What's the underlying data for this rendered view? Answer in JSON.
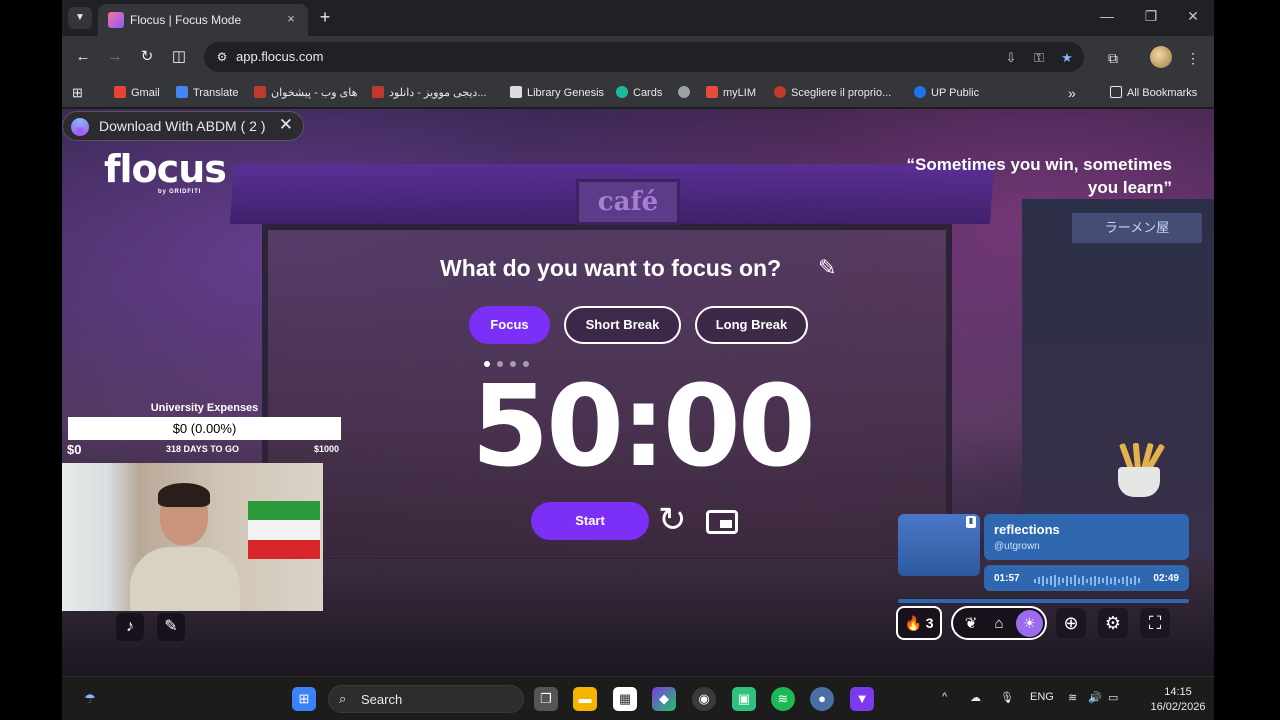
{
  "browser": {
    "tab_title": "Flocus | Focus Mode",
    "tab_close": "×",
    "new_tab": "+",
    "window_controls": {
      "minimize": "—",
      "maximize": "❐",
      "close": "✕"
    },
    "url": "app.flocus.com",
    "bookmarks": [
      {
        "label": "Gmail",
        "color": "#ea4335"
      },
      {
        "label": "Translate",
        "color": "#4285f4"
      },
      {
        "label": "های وب - پیشخوان",
        "color": "#c0392b"
      },
      {
        "label": "دیجی موویز - دانلود...",
        "color": "#c0392b"
      },
      {
        "label": "Library Genesis",
        "color": "#dddddd"
      },
      {
        "label": "Cards",
        "color": "#1abc9c"
      },
      {
        "label": "",
        "color": "#9aa0a6"
      },
      {
        "label": "myLIM",
        "color": "#e74c3c"
      },
      {
        "label": "Scegliere il proprio...",
        "color": "#c0392b"
      },
      {
        "label": "UP Public",
        "color": "#1a73e8"
      }
    ],
    "more_bookmarks": "»",
    "all_bookmarks": "All Bookmarks"
  },
  "extension_banner": {
    "label": "Download With ABDM ( 2 )",
    "close": "✕"
  },
  "app": {
    "brand": "flocus",
    "brand_sub": "by GRIDFITI",
    "quote": "“Sometimes you win, sometimes you learn”",
    "focus_question": "What do you want to focus on?",
    "modes": [
      "Focus",
      "Short Break",
      "Long Break"
    ],
    "active_mode": "Focus",
    "cafe_sign": "café",
    "ramen_sign": "ラーメン屋",
    "timer": "50:00",
    "start_label": "Start"
  },
  "goal": {
    "title": "University Expenses",
    "progress_text": "$0 (0.00%)",
    "progress_fraction": 0.0,
    "min_label": "$0",
    "days_label": "318 DAYS TO GO",
    "max_label": "$1000"
  },
  "player": {
    "title": "reflections",
    "artist": "@utgrown",
    "elapsed": "01:57",
    "duration": "02:49"
  },
  "controls": {
    "streak_count": "3"
  },
  "taskbar": {
    "search_label": "Search",
    "language": "ENG",
    "time": "14:15",
    "date": "16/02/2026"
  },
  "colors": {
    "accent": "#7b2ff7",
    "player_blue": "#2f67b0"
  }
}
